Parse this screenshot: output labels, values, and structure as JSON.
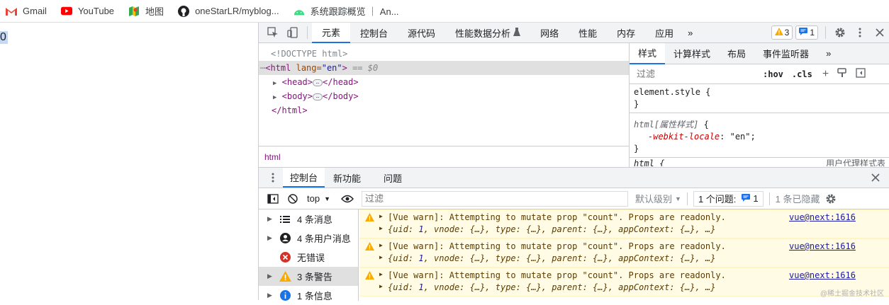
{
  "bookmarks": [
    {
      "label": "Gmail",
      "icon": "gmail-icon"
    },
    {
      "label": "YouTube",
      "icon": "youtube-icon"
    },
    {
      "label": "地图",
      "icon": "maps-icon"
    },
    {
      "label": "oneStarLR/myblog...",
      "icon": "github-icon"
    },
    {
      "label": "系统跟踪概览 ｜ An...",
      "icon": "android-icon"
    }
  ],
  "page": {
    "text": "0"
  },
  "devtools": {
    "tabs": [
      "元素",
      "控制台",
      "源代码",
      "性能数据分析",
      "网络",
      "性能",
      "内存",
      "应用"
    ],
    "more": "»",
    "warn_count": "3",
    "info_count": "1",
    "elements": {
      "doctype": "<!DOCTYPE html>",
      "html_open_tag": "<html ",
      "html_attr": "lang=",
      "html_attr_val": "\"en\"",
      "html_close_bracket": ">",
      "eq": " == $0",
      "head_open": "<head>",
      "head_close": "</head>",
      "body_open": "<body>",
      "body_close": "</body>",
      "html_close": "</html>",
      "ellipsis": "…",
      "breadcrumb": "html"
    },
    "styles": {
      "tabs": [
        "样式",
        "计算样式",
        "布局",
        "事件监听器"
      ],
      "more": "»",
      "filter_placeholder": "过滤",
      "hov": ":hov",
      "cls": ".cls",
      "rule1_selector": "element.style {",
      "rule1_close": "}",
      "rule2_selector": "html[属性样式]",
      "rule2_open": " {",
      "rule2_prop": "-webkit-locale",
      "rule2_val": "\"en\"",
      "rule2_close": "}",
      "rule3_selector": "html {",
      "rule3_note": "用户代理样式表"
    },
    "drawer": {
      "tabs": [
        "控制台",
        "新功能",
        "问题"
      ],
      "context": "top",
      "filter_placeholder": "过滤",
      "levels": "默认级别",
      "issues_label": "1 个问题:",
      "issues_count": "1",
      "hidden": "1 条已隐藏",
      "sidebar": [
        {
          "label": "4 条消息",
          "icon": "list-icon",
          "has_arrow": true
        },
        {
          "label": "4 条用户消息",
          "icon": "user-icon",
          "has_arrow": true
        },
        {
          "label": "无错误",
          "icon": "error-icon",
          "has_arrow": false
        },
        {
          "label": "3 条警告",
          "icon": "warning-icon",
          "has_arrow": true
        },
        {
          "label": "1 条信息",
          "icon": "info-icon",
          "has_arrow": true
        }
      ],
      "messages": [
        {
          "line1": "[Vue warn]: Attempting to mutate prop \"count\". Props are readonly.",
          "source": "vue@next:1616",
          "uid_label": "uid",
          "uid_val": "1"
        },
        {
          "line1": "[Vue warn]: Attempting to mutate prop \"count\". Props are readonly.",
          "source": "vue@next:1616",
          "uid_label": "uid",
          "uid_val": "1"
        },
        {
          "line1": "[Vue warn]: Attempting to mutate prop \"count\". Props are readonly.",
          "source": "vue@next:1616",
          "uid_label": "uid",
          "uid_val": "1"
        }
      ],
      "obj_rest": ", vnode: {…}, type: {…}, parent: {…}, appContext: {…}, …}",
      "watermark": "@稀土掘金技术社区"
    }
  },
  "colors": {
    "accent": "#1a73e8",
    "warn_bg": "#fffbe5",
    "warn_icon": "#f9ab00",
    "error": "#d93025",
    "selected": "#e0e0e0"
  }
}
